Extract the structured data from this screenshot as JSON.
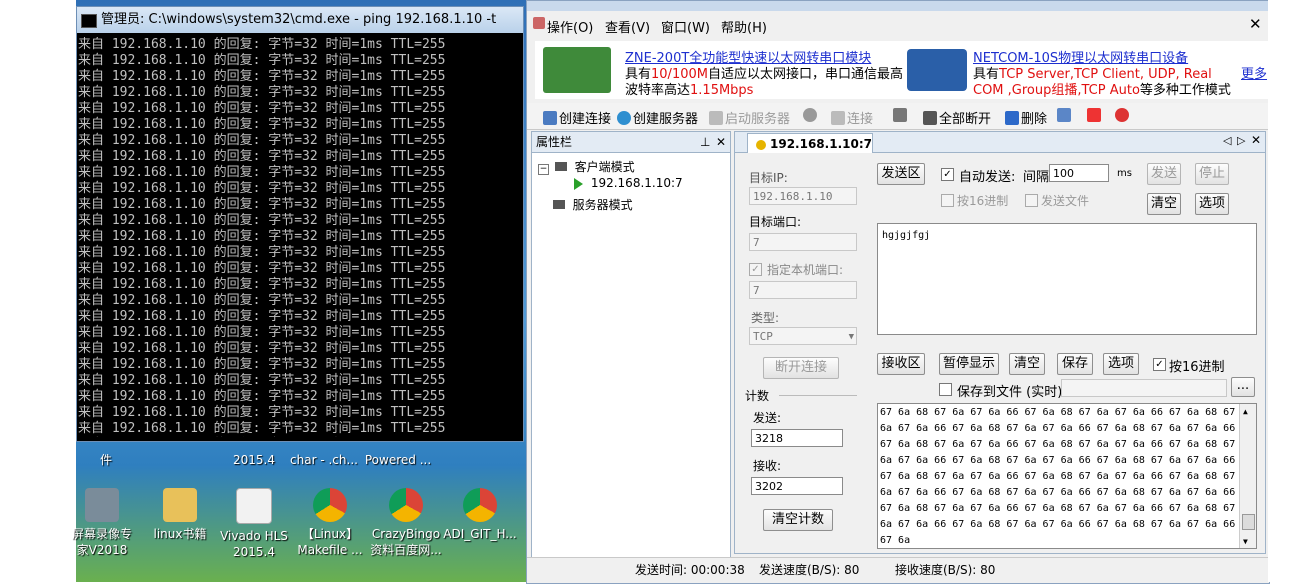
{
  "cmd": {
    "title": "管理员: C:\\windows\\system32\\cmd.exe - ping  192.168.1.10 -t",
    "line": "来自 192.168.1.10 的回复: 字节=32 时间=1ms TTL=255",
    "line_count": 26
  },
  "desktop": {
    "top_labels": [
      "件",
      "2015.4",
      "char - .ch...",
      "Powered ..."
    ],
    "icons": [
      {
        "label": "屏幕录像专\n家V2018",
        "icon": "video-camera-icon"
      },
      {
        "label": "linux书籍",
        "icon": "folder-icon"
      },
      {
        "label": "Vivado HLS\n2015.4",
        "icon": "vivado-icon"
      },
      {
        "label": "【Linux】\nMakefile ...",
        "icon": "chrome-icon"
      },
      {
        "label": "CrazyBingo\n资料百度网...",
        "icon": "chrome-icon"
      },
      {
        "label": "ADI_GIT_H...",
        "icon": "chrome-icon"
      }
    ]
  },
  "app": {
    "menu": [
      "操作(O)",
      "查看(V)",
      "窗口(W)",
      "帮助(H)"
    ],
    "ads": [
      {
        "title": "ZNE-200T全功能型快速以太网转串口模块",
        "line1_a": "具有",
        "line1_red": "10/100M",
        "line1_b": "自适应以太网接口，串口通信最高",
        "line2_a": "波特率高达",
        "line2_red": "1.15Mbps"
      },
      {
        "title": "NETCOM-10S物理以太网转串口设备",
        "line1_a": "具有",
        "line1_red": "TCP Server,TCP Client, UDP, Real",
        "line2_red": "COM ,Group组播,TCP Auto",
        "line2_b": "等多种工作模式"
      }
    ],
    "ad_more": "更多",
    "toolbar": [
      {
        "label": "创建连接",
        "icon": "new-connection-icon",
        "enabled": true
      },
      {
        "label": "创建服务器",
        "icon": "create-server-icon",
        "enabled": true
      },
      {
        "label": "启动服务器",
        "icon": "start-server-icon",
        "enabled": false
      },
      {
        "label": "连接",
        "icon": "connect-icon",
        "enabled": false
      },
      {
        "label": "全部断开",
        "icon": "disconnect-all-icon",
        "enabled": true
      },
      {
        "label": "删除",
        "icon": "delete-icon",
        "enabled": true
      }
    ],
    "prop_title": "属性栏",
    "tree": {
      "client_mode": "客户端模式",
      "client_child": "192.168.1.10:7",
      "server_mode": "服务器模式"
    },
    "tab_label": "192.168.1.10:7",
    "left_panel": {
      "target_ip_label": "目标IP:",
      "target_ip": "192.168.1.10",
      "target_port_label": "目标端口:",
      "target_port": "7",
      "local_port_label": "指定本机端口:",
      "local_port": "7",
      "type_label": "类型:",
      "type_value": "TCP",
      "disconnect_btn": "断开连接",
      "count_label": "计数",
      "send_label": "发送:",
      "send_count": "3218",
      "recv_label": "接收:",
      "recv_count": "3202",
      "clear_count_btn": "清空计数"
    },
    "send_area": {
      "label": "发送区",
      "auto_send": "自动发送:",
      "interval_label": "间隔",
      "interval": "100",
      "unit": "ms",
      "send_btn": "发送",
      "stop_btn": "停止",
      "hex16": "按16进制",
      "send_file": "发送文件",
      "clear_btn": "清空",
      "options_btn": "选项",
      "text": "hgjgjfgj"
    },
    "recv_area": {
      "label": "接收区",
      "pause_btn": "暂停显示",
      "clear_btn": "清空",
      "save_btn": "保存",
      "options_btn": "选项",
      "hex16": "按16进制",
      "save_to_file": "保存到文件 (实时)",
      "browse": "...",
      "lines": [
        "67 6a 68 67 6a 67 6a 66 67 6a 68 67 6a 67 6a 66 67 6a 68 67",
        "6a 67 6a 66 67 6a 68 67 6a 67 6a 66 67 6a 68 67 6a 67 6a 66",
        "67 6a 68 67 6a 67 6a 66 67 6a 68 67 6a 67 6a 66 67 6a 68 67",
        "6a 67 6a 66 67 6a 68 67 6a 67 6a 66 67 6a 68 67 6a 67 6a 66",
        "67 6a 68 67 6a 67 6a 66 67 6a 68 67 6a 67 6a 66 67 6a 68 67",
        "6a 67 6a 66 67 6a 68 67 6a 67 6a 66 67 6a 68 67 6a 67 6a 66",
        "67 6a 68 67 6a 67 6a 66 67 6a 68 67 6a 67 6a 66 67 6a 68 67",
        "6a 67 6a 66 67 6a 68 67 6a 67 6a 66 67 6a 68 67 6a 67 6a 66",
        "67 6a"
      ]
    },
    "status": {
      "send_time": "发送时间: 00:00:38",
      "send_speed": "发送速度(B/S): 80",
      "recv_speed": "接收速度(B/S): 80"
    }
  },
  "colors": {
    "ad_blue": "#1d2fcf",
    "ad_red": "#e01010",
    "cmd_text": "#c0c0c0"
  }
}
